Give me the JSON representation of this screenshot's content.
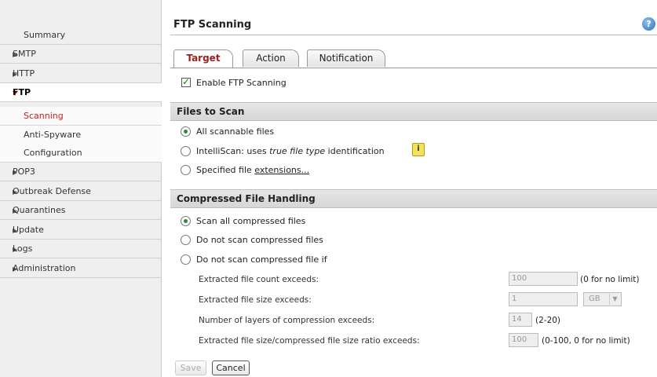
{
  "sidebar": {
    "items": [
      {
        "label": "Summary"
      },
      {
        "label": "SMTP",
        "arrow": "▶"
      },
      {
        "label": "HTTP",
        "arrow": "▶"
      },
      {
        "label": "FTP",
        "arrow": "▼"
      },
      {
        "label": "Scanning"
      },
      {
        "label": "Anti-Spyware"
      },
      {
        "label": "Configuration"
      },
      {
        "label": "POP3",
        "arrow": "▶"
      },
      {
        "label": "Outbreak Defense",
        "arrow": "▶"
      },
      {
        "label": "Quarantines",
        "arrow": "▶"
      },
      {
        "label": "Update",
        "arrow": "▶"
      },
      {
        "label": "Logs",
        "arrow": "▶"
      },
      {
        "label": "Administration",
        "arrow": "▶"
      }
    ]
  },
  "page": {
    "title": "FTP Scanning",
    "help": "?"
  },
  "tabs": [
    {
      "label": "Target"
    },
    {
      "label": "Action"
    },
    {
      "label": "Notification"
    }
  ],
  "enable": {
    "label": "Enable FTP Scanning"
  },
  "files_to_scan": {
    "heading": "Files to Scan",
    "all": "All scannable files",
    "intelli_prefix": "IntelliScan: uses ",
    "intelli_italic": "true file type",
    "intelli_suffix": " identification",
    "note_icon": "i",
    "specified_prefix": "Specified file ",
    "specified_link": "extensions..."
  },
  "compressed": {
    "heading": "Compressed File Handling",
    "scan_all": "Scan all compressed files",
    "do_not_scan": "Do not scan compressed files",
    "do_not_scan_if": "Do not scan compressed file if",
    "count_label": "Extracted file count exceeds:",
    "count_value": "100",
    "count_hint": "(0 for no limit)",
    "size_label": "Extracted file size exceeds:",
    "size_value": "1",
    "size_unit": "GB",
    "layers_label": "Number of layers of compression exceeds:",
    "layers_value": "14",
    "layers_hint": "(2-20)",
    "ratio_label": "Extracted file size/compressed file size ratio exceeds:",
    "ratio_value": "100",
    "ratio_hint": "(0-100, 0 for no limit)"
  },
  "buttons": {
    "save": "Save",
    "cancel": "Cancel"
  }
}
